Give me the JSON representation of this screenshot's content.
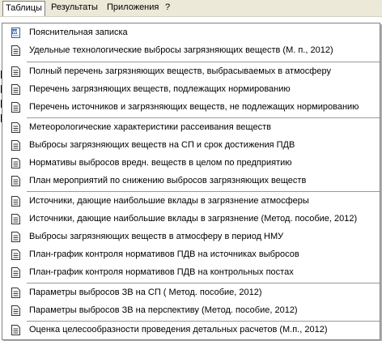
{
  "menubar": {
    "items": [
      "Таблицы",
      "Результаты",
      "Приложения",
      "?"
    ]
  },
  "dropdown": {
    "items": [
      {
        "label": "Пояснительная записка",
        "icon": "word-document-icon"
      },
      {
        "label": "Удельные технологические выбросы загрязняющих веществ (М. п.,  2012)",
        "icon": "document-icon"
      },
      {
        "label": "Полный перечень загрязняющих веществ, выбрасываемых в атмосферу",
        "icon": "document-icon"
      },
      {
        "label": "Перечень загрязняющих веществ, подлежащих нормированию",
        "icon": "document-icon"
      },
      {
        "label": "Перечень источников и загрязняющих веществ, не подлежащих нормированию",
        "icon": "document-icon"
      },
      {
        "label": "Метеорологические характеристики рассеивания веществ",
        "icon": "document-icon"
      },
      {
        "label": "Выбросы загрязняющих веществ на СП и срок достижения ПДВ",
        "icon": "document-icon"
      },
      {
        "label": "Нормативы выбросов вредн. веществ в целом по предприятию",
        "icon": "document-icon"
      },
      {
        "label": "План мероприятий по снижению выбросов загрязняющих веществ",
        "icon": "document-icon"
      },
      {
        "label": "Источники, дающие наибольшие вклады в загрязнение атмосферы",
        "icon": "document-icon"
      },
      {
        "label": "Источники, дающие наибольшие вклады в загрязнение (Метод. пособие, 2012)",
        "icon": "document-icon"
      },
      {
        "label": "Выбросы загрязняющих веществ в атмосферу в период НМУ",
        "icon": "document-icon"
      },
      {
        "label": "План-график контроля нормативов ПДВ на источниках выбросов",
        "icon": "document-icon"
      },
      {
        "label": "План-график контроля нормативов ПДВ на контрольных постах",
        "icon": "document-icon"
      },
      {
        "label": "Параметры выбросов ЗВ на СП  ( Метод. пособие, 2012)",
        "icon": "document-icon"
      },
      {
        "label": "Параметры выбросов ЗВ на перспективу  (Метод. пособие, 2012)",
        "icon": "document-icon"
      },
      {
        "label": "Оценка целесообразности проведения детальных расчетов  (М.п., 2012)",
        "icon": "document-icon"
      }
    ]
  }
}
